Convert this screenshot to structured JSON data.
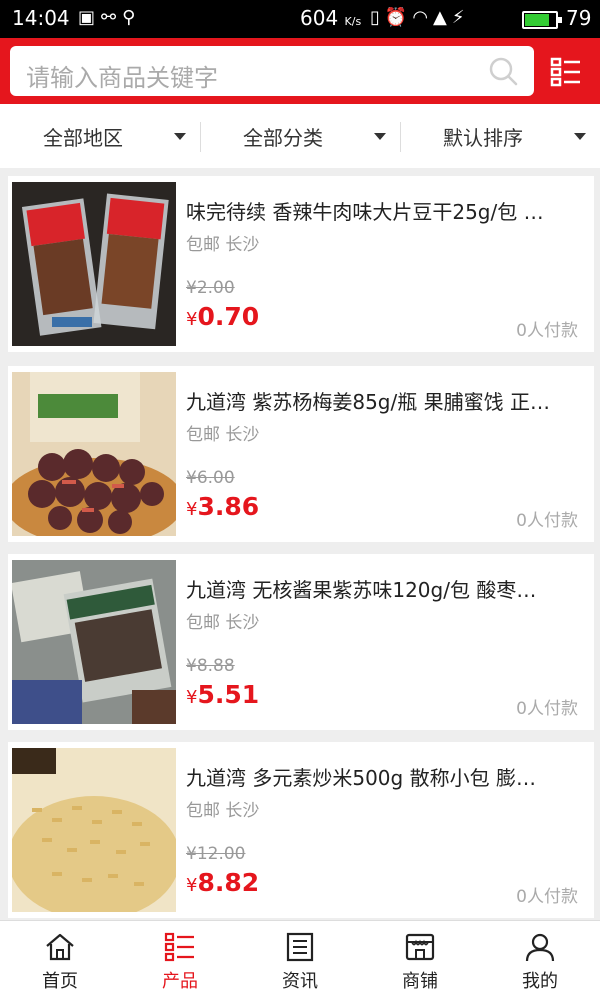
{
  "status_bar": {
    "time": "14:04",
    "net_speed": "604",
    "net_speed_unit": "K/s",
    "battery": "79",
    "battery_level": 0.79
  },
  "search": {
    "placeholder": "请输入商品关键字"
  },
  "filters": [
    {
      "label": "全部地区"
    },
    {
      "label": "全部分类"
    },
    {
      "label": "默认排序"
    }
  ],
  "products": [
    {
      "title": "味完待续 香辣牛肉味大片豆干25g/包 …",
      "meta": "包邮 长沙",
      "old_price": "¥2.00",
      "currency": "¥",
      "price": "0.70",
      "sold": "0人付款"
    },
    {
      "title": "九道湾 紫苏杨梅姜85g/瓶 果脯蜜饯 正…",
      "meta": "包邮 长沙",
      "old_price": "¥6.00",
      "currency": "¥",
      "price": "3.86",
      "sold": "0人付款"
    },
    {
      "title": "九道湾 无核酱果紫苏味120g/包 酸枣…",
      "meta": "包邮 长沙",
      "old_price": "¥8.88",
      "currency": "¥",
      "price": "5.51",
      "sold": "0人付款"
    },
    {
      "title": "九道湾 多元素炒米500g 散称小包 膨…",
      "meta": "包邮 长沙",
      "old_price": "¥12.00",
      "currency": "¥",
      "price": "8.82",
      "sold": "0人付款"
    }
  ],
  "tabs": [
    {
      "label": "首页",
      "icon": "home-icon"
    },
    {
      "label": "产品",
      "icon": "list-icon"
    },
    {
      "label": "资讯",
      "icon": "news-icon"
    },
    {
      "label": "商铺",
      "icon": "store-icon"
    },
    {
      "label": "我的",
      "icon": "user-icon"
    }
  ],
  "colors": {
    "brand": "#e5161d",
    "muted": "#999999"
  }
}
